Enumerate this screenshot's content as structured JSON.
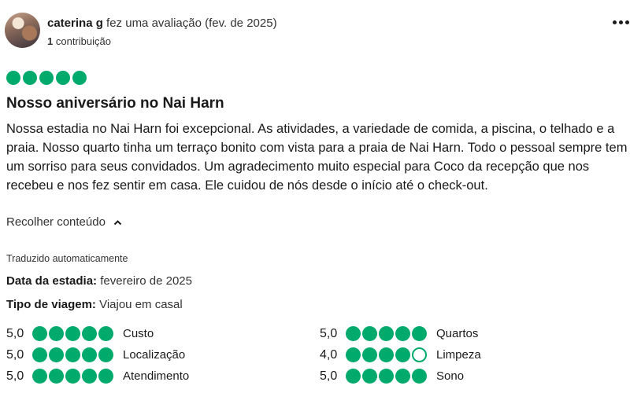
{
  "review": {
    "author": "caterina g",
    "action": "fez uma avaliação (fev. de 2025)",
    "contribution_count": "1",
    "contribution_label": "contribuição",
    "rating": 5,
    "title": "Nosso aniversário no Nai Harn",
    "body": "Nossa estadia no Nai Harn foi excepcional. As atividades, a variedade de comida, a piscina, o telhado e a praia. Nosso quarto tinha um terraço bonito com vista para a praia de Nai Harn. Todo o pessoal sempre tem um sorriso para seus convidados. Um agradecimento muito especial para Coco da recepção que nos recebeu e nos fez sentir em casa. Ele cuidou de nós desde o início até o check-out.",
    "collapse_label": "Recolher conteúdo",
    "auto_translated": "Traduzido automaticamente",
    "stay_date_label": "Data da estadia:",
    "stay_date": "fevereiro de 2025",
    "trip_type_label": "Tipo de viagem:",
    "trip_type": "Viajou em casal"
  },
  "subratings": [
    {
      "score": "5,0",
      "value": 5,
      "label": "Custo"
    },
    {
      "score": "5,0",
      "value": 5,
      "label": "Quartos"
    },
    {
      "score": "5,0",
      "value": 5,
      "label": "Localização"
    },
    {
      "score": "4,0",
      "value": 4,
      "label": "Limpeza"
    },
    {
      "score": "5,0",
      "value": 5,
      "label": "Atendimento"
    },
    {
      "score": "5,0",
      "value": 5,
      "label": "Sono"
    }
  ],
  "icons": {
    "menu": "more-horizontal-icon",
    "collapse": "chevron-up-icon"
  },
  "colors": {
    "rating_green": "#00aa6c",
    "text": "#1a1a1a"
  }
}
